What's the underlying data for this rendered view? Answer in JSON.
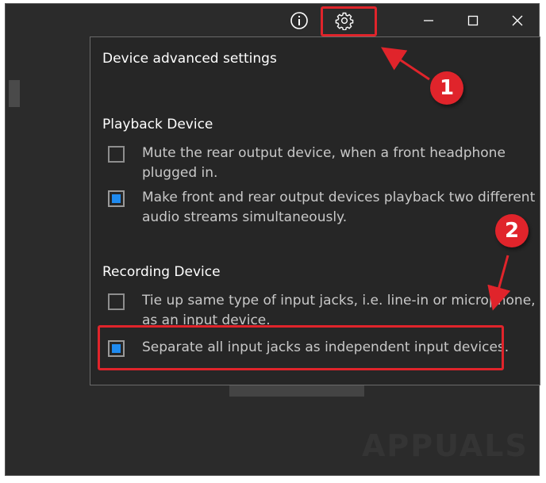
{
  "window": {
    "controls": {
      "info": "info-icon",
      "settings": "gear-icon",
      "minimize": "minimize-icon",
      "maximize": "maximize-icon",
      "close": "close-icon"
    }
  },
  "panel": {
    "title": "Device advanced settings",
    "playback": {
      "header": "Playback Device",
      "options": [
        {
          "label": "Mute the rear output device, when a front headphone plugged in.",
          "checked": false
        },
        {
          "label": "Make front and rear output devices playback two different audio streams simultaneously.",
          "checked": true
        }
      ]
    },
    "recording": {
      "header": "Recording Device",
      "options": [
        {
          "label": "Tie up same type of input jacks, i.e. line-in or microphone, as an input device.",
          "checked": false
        },
        {
          "label": "Separate all input jacks as independent input devices.",
          "checked": true
        }
      ]
    }
  },
  "annotations": {
    "step1": "1",
    "step2": "2",
    "color": "#e0242b"
  },
  "watermark": {
    "text": "APPUALS"
  },
  "colors": {
    "background": "#2b2b2b",
    "panel": "#262626",
    "accent": "#1f8bf0",
    "highlight": "#e0242b"
  }
}
